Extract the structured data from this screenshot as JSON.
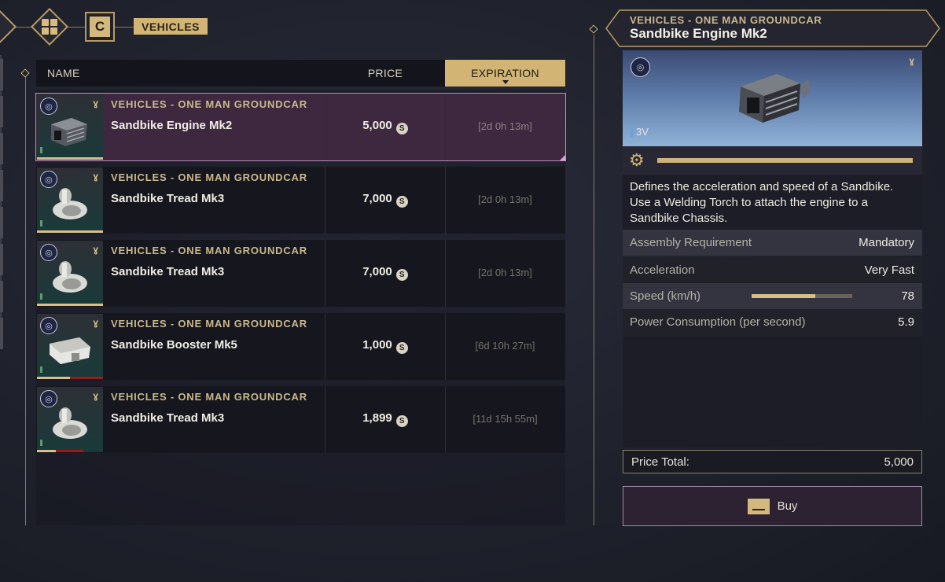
{
  "breadcrumb": {
    "key": "C",
    "label": "VEHICLES"
  },
  "table": {
    "headers": {
      "name": "NAME",
      "price": "PRICE",
      "expiration": "EXPIRATION"
    },
    "rows": [
      {
        "category": "VEHICLES - ONE MAN GROUNDCAR",
        "name": "Sandbike Engine Mk2",
        "price": "5,000",
        "expiration": "[2d 0h 13m]",
        "selected": true,
        "art": "engine",
        "condition": 1.0,
        "wear": 0
      },
      {
        "category": "VEHICLES - ONE MAN GROUNDCAR",
        "name": "Sandbike Tread Mk3",
        "price": "7,000",
        "expiration": "[2d 0h 13m]",
        "selected": false,
        "art": "tread",
        "condition": 1.0,
        "wear": 0
      },
      {
        "category": "VEHICLES - ONE MAN GROUNDCAR",
        "name": "Sandbike Tread Mk3",
        "price": "7,000",
        "expiration": "[2d 0h 13m]",
        "selected": false,
        "art": "tread",
        "condition": 1.0,
        "wear": 0
      },
      {
        "category": "VEHICLES - ONE MAN GROUNDCAR",
        "name": "Sandbike Booster Mk5",
        "price": "1,000",
        "expiration": "[6d 10h 27m]",
        "selected": false,
        "art": "booster",
        "condition": 0.5,
        "wear": 0.5
      },
      {
        "category": "VEHICLES - ONE MAN GROUNDCAR",
        "name": "Sandbike Tread Mk3",
        "price": "1,899",
        "expiration": "[11d 15h 55m]",
        "selected": false,
        "art": "tread",
        "condition": 0.28,
        "wear": 0.42
      }
    ]
  },
  "detail": {
    "category": "VEHICLES - ONE MAN GROUNDCAR",
    "name": "Sandbike Engine Mk2",
    "volume": "3V",
    "durability": 1.0,
    "description": "Defines the acceleration and speed of a Sandbike. Use a Welding Torch to attach the engine to a Sandbike Chassis.",
    "stats": [
      {
        "label": "Assembly Requirement",
        "value": "Mandatory"
      },
      {
        "label": "Acceleration",
        "value": "Very Fast"
      },
      {
        "label": "Speed (km/h)",
        "value": "78",
        "fill": 0.63
      },
      {
        "label": "Power Consumption (per second)",
        "value": "5.9"
      }
    ],
    "price_total_label": "Price Total:",
    "price_total": "5,000",
    "buy_label": "Buy"
  },
  "icons": {
    "back": "diamond-arrow-icon",
    "grid": "grid-icon",
    "badge": "faction-badge-icon",
    "tier": "tier-icon",
    "coin": "solari-coin-icon",
    "gear": "gear-icon"
  },
  "colors": {
    "accent": "#d2b474",
    "selected_row": "#3d2840",
    "wear_red": "#9b1b1b"
  }
}
